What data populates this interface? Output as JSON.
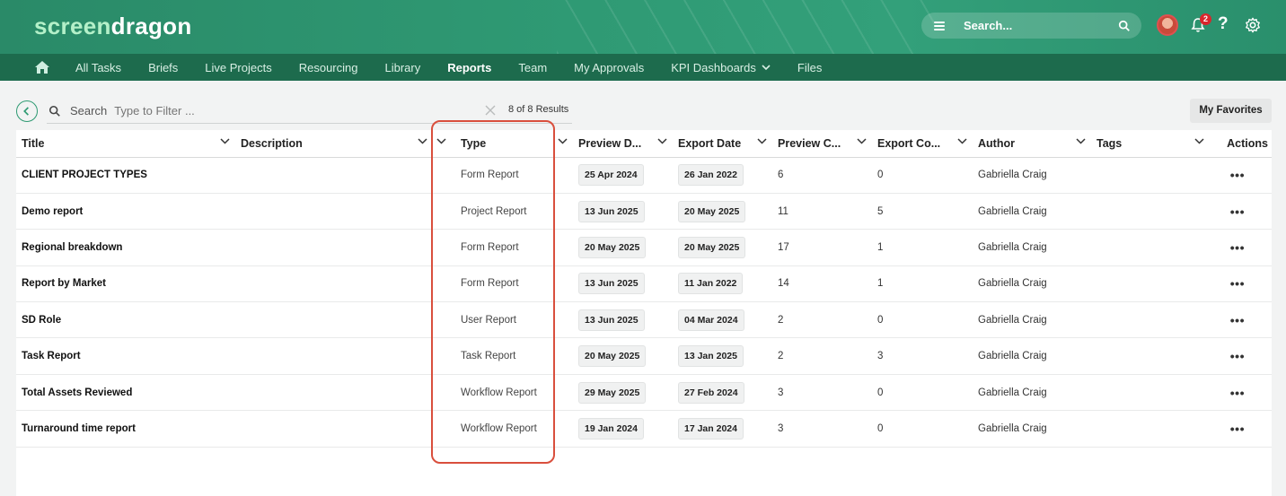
{
  "brand": {
    "part1": "screen",
    "part2": "dragon",
    "accent": "#2e9a72",
    "nav_bg": "#1d6b4d",
    "highlight_color": "#d94f3d"
  },
  "topbar": {
    "search_placeholder": "Search...",
    "notification_count": "2",
    "help_label": "?"
  },
  "nav": {
    "home_icon": "home-icon",
    "items": [
      {
        "label": "All Tasks"
      },
      {
        "label": "Briefs"
      },
      {
        "label": "Live Projects"
      },
      {
        "label": "Resourcing"
      },
      {
        "label": "Library"
      },
      {
        "label": "Reports",
        "active": true
      },
      {
        "label": "Team"
      },
      {
        "label": "My Approvals"
      },
      {
        "label": "KPI Dashboards",
        "dropdown": true
      },
      {
        "label": "Files"
      }
    ]
  },
  "toolbar": {
    "search_label": "Search",
    "filter_placeholder": "Type to Filter ...",
    "results": "8 of 8 Results",
    "favorites": "My Favorites"
  },
  "table": {
    "columns": [
      "Title",
      "Description",
      "Type",
      "Preview D...",
      "Export Date",
      "Preview C...",
      "Export Co...",
      "Author",
      "Tags",
      "Actions"
    ],
    "rows": [
      {
        "title": "CLIENT PROJECT TYPES",
        "description": "",
        "type": "Form Report",
        "preview_date": "25 Apr 2024",
        "export_date": "26 Jan 2022",
        "preview_count": "6",
        "export_count": "0",
        "author": "Gabriella Craig",
        "tags": "",
        "actions": "•••"
      },
      {
        "title": "Demo report",
        "description": "",
        "type": "Project Report",
        "preview_date": "13 Jun 2025",
        "export_date": "20 May 2025",
        "preview_count": "11",
        "export_count": "5",
        "author": "Gabriella Craig",
        "tags": "",
        "actions": "•••"
      },
      {
        "title": "Regional breakdown",
        "description": "",
        "type": "Form Report",
        "preview_date": "20 May 2025",
        "export_date": "20 May 2025",
        "preview_count": "17",
        "export_count": "1",
        "author": "Gabriella Craig",
        "tags": "",
        "actions": "•••"
      },
      {
        "title": "Report by Market",
        "description": "",
        "type": "Form Report",
        "preview_date": "13 Jun 2025",
        "export_date": "11 Jan 2022",
        "preview_count": "14",
        "export_count": "1",
        "author": "Gabriella Craig",
        "tags": "",
        "actions": "•••"
      },
      {
        "title": "SD Role",
        "description": "",
        "type": "User Report",
        "preview_date": "13 Jun 2025",
        "export_date": "04 Mar 2024",
        "preview_count": "2",
        "export_count": "0",
        "author": "Gabriella Craig",
        "tags": "",
        "actions": "•••"
      },
      {
        "title": "Task Report",
        "description": "",
        "type": "Task Report",
        "preview_date": "20 May 2025",
        "export_date": "13 Jan 2025",
        "preview_count": "2",
        "export_count": "3",
        "author": "Gabriella Craig",
        "tags": "",
        "actions": "•••"
      },
      {
        "title": "Total Assets Reviewed",
        "description": "",
        "type": "Workflow Report",
        "preview_date": "29 May 2025",
        "export_date": "27 Feb 2024",
        "preview_count": "3",
        "export_count": "0",
        "author": "Gabriella Craig",
        "tags": "",
        "actions": "•••"
      },
      {
        "title": "Turnaround time report",
        "description": "",
        "type": "Workflow Report",
        "preview_date": "19 Jan 2024",
        "export_date": "17 Jan 2024",
        "preview_count": "3",
        "export_count": "0",
        "author": "Gabriella Craig",
        "tags": "",
        "actions": "•••"
      }
    ]
  }
}
